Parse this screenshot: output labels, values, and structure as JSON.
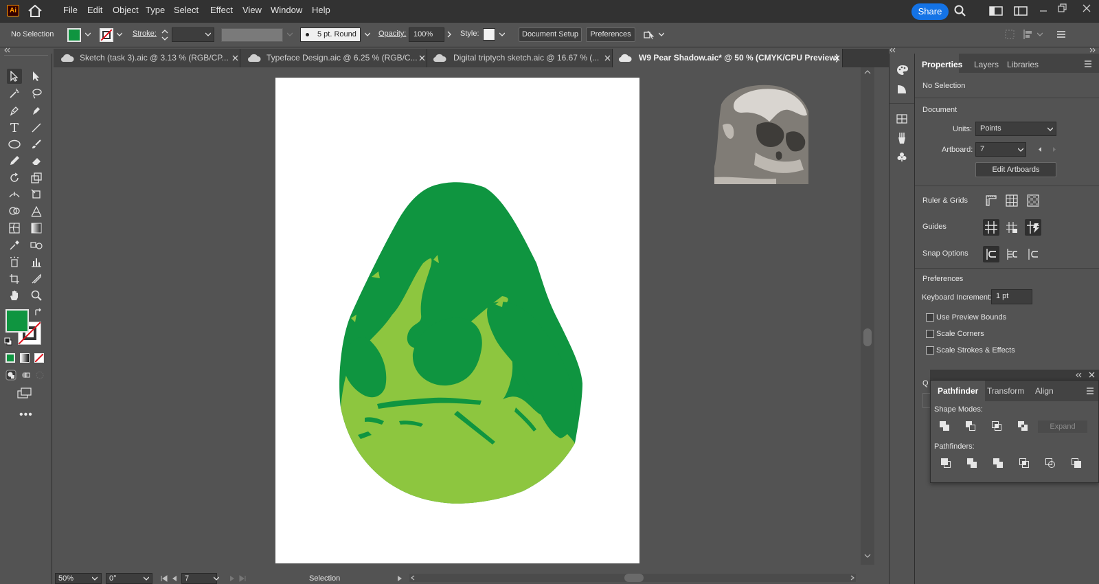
{
  "menubar": {
    "logo": "Ai",
    "items": [
      "File",
      "Edit",
      "Object",
      "Type",
      "Select",
      "Effect",
      "View",
      "Window",
      "Help"
    ],
    "share": "Share"
  },
  "control": {
    "selection": "No Selection",
    "stroke_label": "Stroke:",
    "brush": "5 pt. Round",
    "opacity_label": "Opacity:",
    "opacity": "100%",
    "style_label": "Style:",
    "document_setup": "Document Setup",
    "preferences": "Preferences",
    "fill_color": "#0f9540"
  },
  "tabs": [
    {
      "label": "Sketch (task 3).aic @ 3.13 % (RGB/CP..."
    },
    {
      "label": "Typeface Design.aic @ 6.25 % (RGB/C..."
    },
    {
      "label": "Digital triptych sketch.aic @ 16.67 % (..."
    },
    {
      "label": "W9 Pear Shadow.aic* @ 50 % (CMYK/CPU Preview)"
    }
  ],
  "properties": {
    "tabs": [
      "Properties",
      "Layers",
      "Libraries"
    ],
    "selection": "No Selection",
    "document": "Document",
    "units_label": "Units:",
    "units": "Points",
    "artboard_label": "Artboard:",
    "artboard": "7",
    "edit_artboards": "Edit Artboards",
    "ruler_grids": "Ruler & Grids",
    "guides": "Guides",
    "snap_options": "Snap Options",
    "preferences": "Preferences",
    "keyboard_increment_label": "Keyboard Increment:",
    "keyboard_increment": "1 pt",
    "checkboxes": [
      "Use Preview Bounds",
      "Scale Corners",
      "Scale Strokes & Effects"
    ],
    "quick_hint": "Q"
  },
  "pathfinder": {
    "tabs": [
      "Pathfinder",
      "Transform",
      "Align"
    ],
    "shape_modes": "Shape Modes:",
    "expand": "Expand",
    "pathfinders": "Pathfinders:"
  },
  "status": {
    "zoom": "50%",
    "rotation": "0°",
    "artboard": "7",
    "tool": "Selection"
  },
  "colors": {
    "dark_green": "#0f9540",
    "light_green": "#8dc63f",
    "accent_blue": "#1473e6"
  }
}
